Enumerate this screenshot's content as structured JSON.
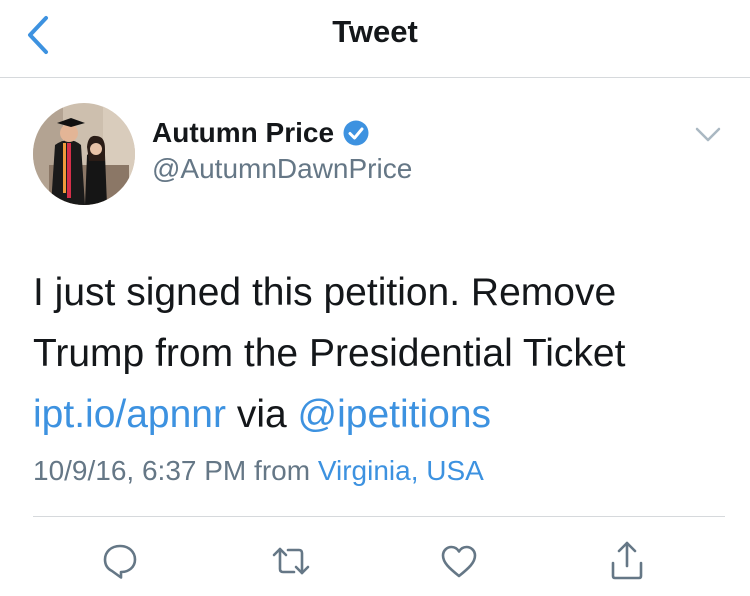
{
  "nav": {
    "title": "Tweet"
  },
  "user": {
    "name": "Autumn Price",
    "handle": "@AutumnDawnPrice",
    "verified": true
  },
  "tweet": {
    "text_line1": "I just signed this petition. Remove",
    "text_line2": "Trump from the Presidential Ticket",
    "link": "ipt.io/apnnr",
    "via": "via",
    "mention": "@ipetitions",
    "timestamp": "10/9/16, 6:37 PM",
    "from_label": "from",
    "location": "Virginia, USA"
  },
  "colors": {
    "accent": "#3d92e0",
    "muted": "#657786",
    "text": "#14171a",
    "divider": "#d6d9dc"
  },
  "icons": [
    "back-chevron-icon",
    "verified-badge-icon",
    "chevron-down-icon",
    "reply-icon",
    "retweet-icon",
    "like-icon",
    "share-icon"
  ]
}
